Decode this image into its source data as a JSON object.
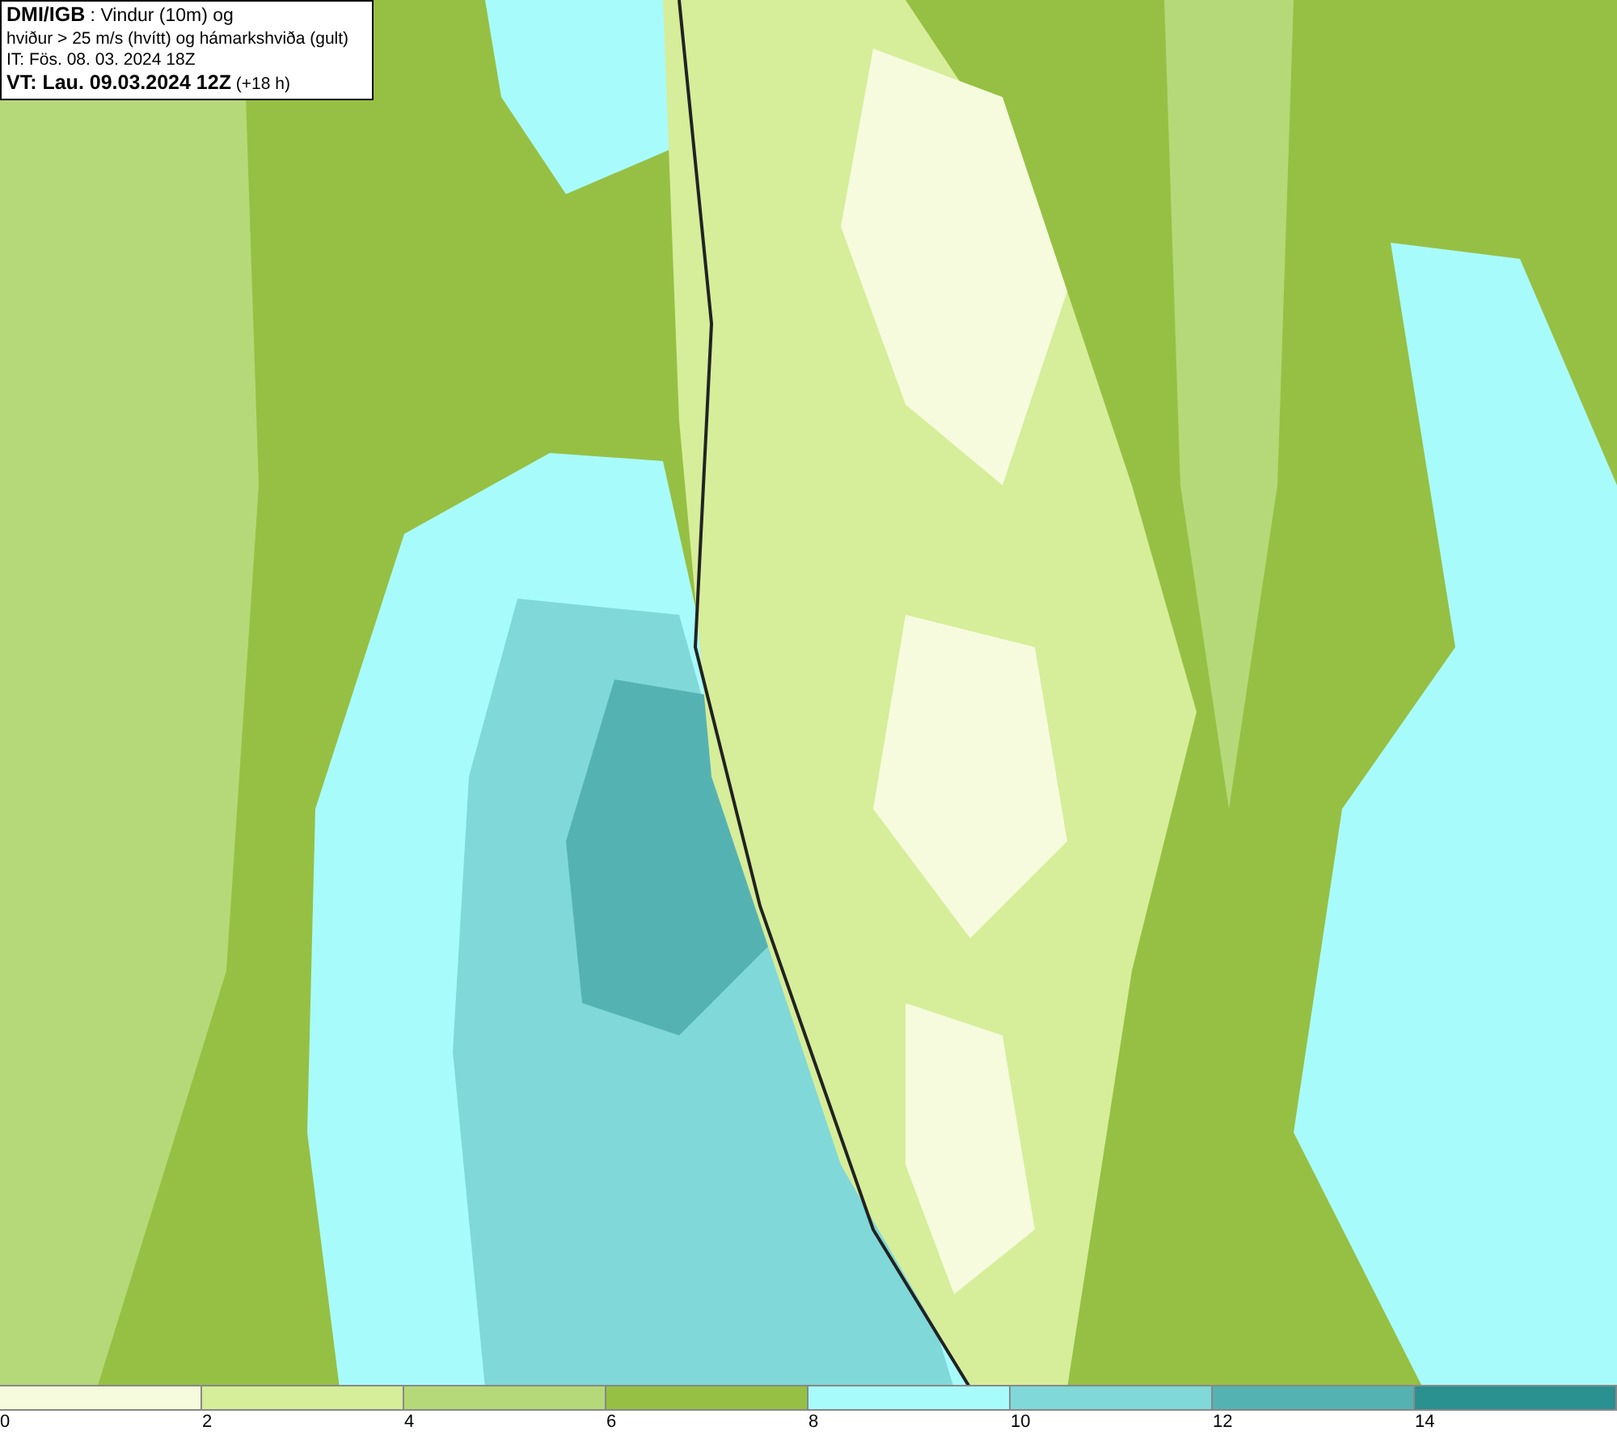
{
  "info_box": {
    "lines": [
      "**DMI/IGB** : Vindur (10m) og",
      "hviður > 25 m/s (hvítt) og hámarkshviða (gult)",
      "IT: Fös. 08. 03. 2024 18Z",
      "**VT: Lau. 09.03.2024 12Z** (+18 h)"
    ]
  },
  "legend": {
    "segments": [
      {
        "color": "#f5fbdc"
      },
      {
        "color": "#d6ed9a"
      },
      {
        "color": "#b5d978"
      },
      {
        "color": "#96c043"
      },
      {
        "color": "#a8fbfb"
      },
      {
        "color": "#80d8d8"
      },
      {
        "color": "#55b2b2"
      },
      {
        "color": "#2a9090"
      }
    ],
    "ticks": [
      "0",
      "2",
      "4",
      "6",
      "8",
      "10",
      "12",
      "14"
    ]
  }
}
